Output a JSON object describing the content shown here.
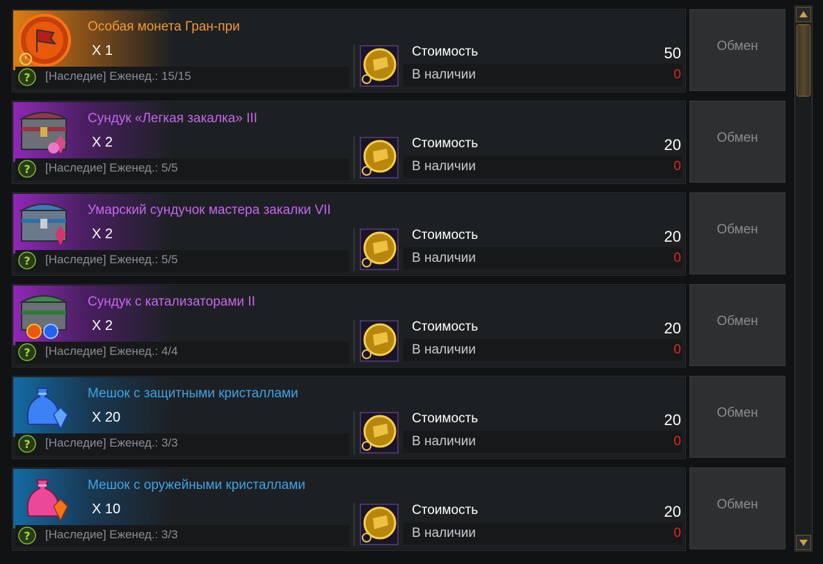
{
  "common": {
    "cost_label": "Стоимость",
    "avail_label": "В наличии",
    "exchange_label": "Обмен"
  },
  "items": [
    {
      "name": "Особая монета Гран-при",
      "qty": "X 1",
      "limit": "[Наследие] Еженед.: 15/15",
      "cost": "50",
      "available": "0",
      "rarity": "orange",
      "icon": "grand-prix-coin-icon"
    },
    {
      "name": "Сундук «Легкая закалка» III",
      "qty": "X 2",
      "limit": "[Наследие] Еженед.: 5/5",
      "cost": "20",
      "available": "0",
      "rarity": "purple",
      "icon": "chest-icon"
    },
    {
      "name": "Умарский сундучок мастера закалки VII",
      "qty": "X 2",
      "limit": "[Наследие] Еженед.: 5/5",
      "cost": "20",
      "available": "0",
      "rarity": "purple",
      "icon": "chest-icon"
    },
    {
      "name": "Сундук с катализаторами II",
      "qty": "X 2",
      "limit": "[Наследие] Еженед.: 4/4",
      "cost": "20",
      "available": "0",
      "rarity": "purple",
      "icon": "chest-icon"
    },
    {
      "name": "Мешок с защитными кристаллами",
      "qty": "X 20",
      "limit": "[Наследие] Еженед.: 3/3",
      "cost": "20",
      "available": "0",
      "rarity": "blue",
      "icon": "bag-icon"
    },
    {
      "name": "Мешок с оружейными кристаллами",
      "qty": "X 10",
      "limit": "[Наследие] Еженед.: 3/3",
      "cost": "20",
      "available": "0",
      "rarity": "blue",
      "icon": "bag-icon"
    }
  ],
  "colors": {
    "orange": "#f39a33",
    "purple": "#c865f0",
    "blue": "#3fa3e6",
    "available_zero": "#e5261f"
  }
}
